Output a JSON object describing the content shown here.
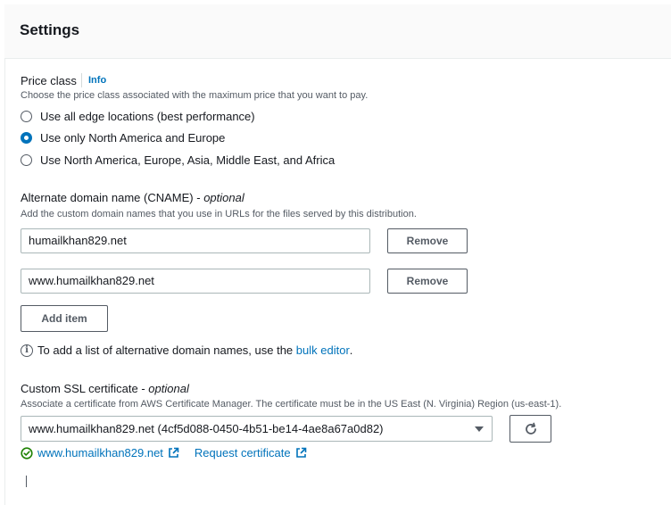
{
  "header": {
    "title": "Settings"
  },
  "price_class": {
    "label": "Price class",
    "info": "Info",
    "description": "Choose the price class associated with the maximum price that you want to pay.",
    "options": [
      {
        "label": "Use all edge locations (best performance)",
        "selected": false
      },
      {
        "label": "Use only North America and Europe",
        "selected": true
      },
      {
        "label": "Use North America, Europe, Asia, Middle East, and Africa",
        "selected": false
      }
    ]
  },
  "cname": {
    "label": "Alternate domain name (CNAME) - ",
    "optional": "optional",
    "description": "Add the custom domain names that you use in URLs for the files served by this distribution.",
    "items": [
      {
        "value": "humailkhan829.net",
        "remove_label": "Remove"
      },
      {
        "value": "www.humailkhan829.net",
        "remove_label": "Remove"
      }
    ],
    "add_item_label": "Add item",
    "note_prefix": "To add a list of alternative domain names, use the ",
    "note_link": "bulk editor",
    "note_suffix": "."
  },
  "ssl": {
    "label": "Custom SSL certificate - ",
    "optional": "optional",
    "description": "Associate a certificate from AWS Certificate Manager. The certificate must be in the US East (N. Virginia) Region (us-east-1).",
    "selected": "www.humailkhan829.net (4cf5d088-0450-4b51-be14-4ae8a67a0d82)",
    "cert_link": "www.humailkhan829.net",
    "request_link": "Request certificate"
  },
  "colors": {
    "accent": "#0073bb",
    "success": "#1d8102",
    "text": "#16191f",
    "muted": "#545b64"
  }
}
